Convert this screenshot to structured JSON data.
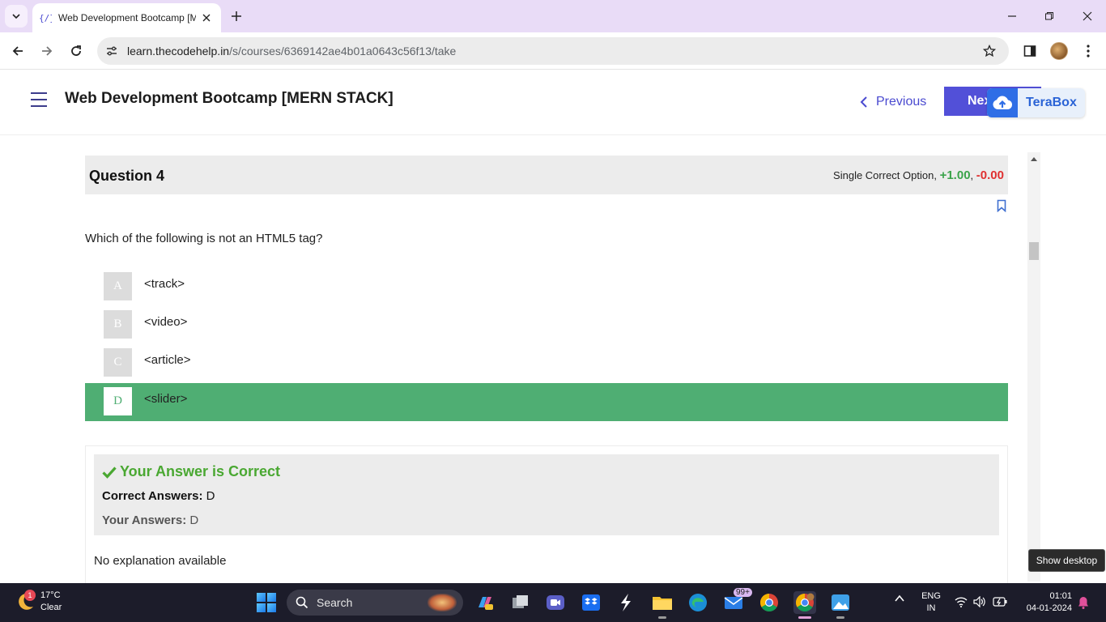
{
  "browser": {
    "tab_title": "Web Development Bootcamp [M",
    "url_domain": "learn.thecodehelp.in",
    "url_path": "/s/courses/6369142ae4b01a0643c56f13/take"
  },
  "header": {
    "course_title": "Web Development Bootcamp [MERN STACK]",
    "previous_label": "Previous",
    "next_label": "Next",
    "terabox_label": "TeraBox"
  },
  "question": {
    "title": "Question 4",
    "marking_type": "Single Correct Option,",
    "positive_marks": "+1.00",
    "separator": ",",
    "negative_marks": "-0.00",
    "text": "Which of the following is not an HTML5 tag?",
    "options": [
      {
        "letter": "A",
        "text": "<track>",
        "selected": false
      },
      {
        "letter": "B",
        "text": "<video>",
        "selected": false
      },
      {
        "letter": "C",
        "text": "<article>",
        "selected": false
      },
      {
        "letter": "D",
        "text": "<slider>",
        "selected": true
      }
    ]
  },
  "result": {
    "status": "Your Answer is Correct",
    "correct_label": "Correct Answers:",
    "correct_value": "D",
    "yours_label": "Your Answers:",
    "yours_value": "D",
    "explanation": "No explanation available"
  },
  "tooltip": "Show desktop",
  "taskbar": {
    "weather_temp": "17°C",
    "weather_desc": "Clear",
    "weather_badge": "1",
    "search_label": "Search",
    "mail_badge": "99+",
    "lang_top": "ENG",
    "lang_bottom": "IN",
    "time": "01:01",
    "date": "04-01-2024"
  },
  "colors": {
    "accent": "#5250d8",
    "correct_green": "#4fae73",
    "status_green": "#4aa832",
    "negative_red": "#e03030"
  },
  "icons": [
    "chevron-down-icon",
    "codehelp-favicon-icon",
    "close-icon",
    "plus-icon",
    "minimize-icon",
    "maximize-icon",
    "back-arrow-icon",
    "forward-arrow-icon",
    "reload-icon",
    "site-settings-icon",
    "star-icon",
    "sidepanel-icon",
    "kebab-menu-icon",
    "hamburger-icon",
    "chevron-left-icon",
    "cloud-upload-icon",
    "bookmark-icon",
    "check-icon",
    "windows-start-icon",
    "search-icon"
  ]
}
